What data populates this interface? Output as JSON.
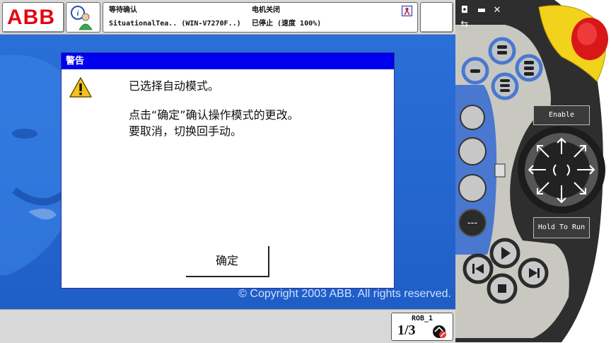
{
  "header": {
    "logo": "ABB",
    "status": {
      "line1_left": "等待确认",
      "line2_left": "SituationalTea.. (WIN-V7270F..)",
      "line1_right": "电机关闭",
      "line2_right": "已停止 (速度 100%)"
    }
  },
  "dialog": {
    "title": "警告",
    "line1": "已选择自动模式。",
    "line2": "点击“确定”确认操作模式的更改。",
    "line3": "要取消，切换回手动。",
    "ok_label": "确定"
  },
  "background": {
    "copyright": "© Copyright 2003 ABB. All rights reserved."
  },
  "bottombar": {
    "rob_label": "ROB_1",
    "rob_fraction": "1/3"
  },
  "pendant": {
    "enable_label": "Enable",
    "hold_label": "Hold To Run"
  },
  "colors": {
    "abb_red": "#e30613",
    "title_blue": "#0000ee",
    "main_blue": "#2465cf",
    "pendant_dark": "#3b3b3b",
    "button_ring": "#4a78d0"
  },
  "icons": [
    "info-user-icon",
    "warning-icon",
    "auto-mode-icon",
    "robot-icon"
  ]
}
